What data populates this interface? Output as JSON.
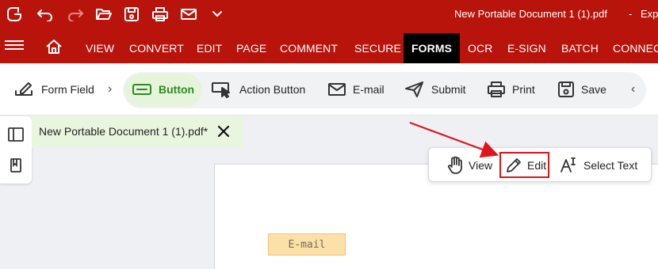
{
  "titlebar": {
    "doc_title": "New Portable Document 1 (1).pdf",
    "separator": "-",
    "app_title": "Exp"
  },
  "menubar": {
    "items": [
      "VIEW",
      "CONVERT",
      "EDIT",
      "PAGE",
      "COMMENT",
      "SECURE",
      "FORMS",
      "OCR",
      "E-SIGN",
      "BATCH",
      "CONNEC"
    ],
    "active": "FORMS"
  },
  "toolbar": {
    "form_field": "Form Field",
    "button": "Button",
    "action_button": "Action Button",
    "email": "E-mail",
    "submit": "Submit",
    "print": "Print",
    "save": "Save"
  },
  "doctab": {
    "label": "New Portable Document 1 (1).pdf*"
  },
  "page": {
    "email_field_label": "E-mail"
  },
  "mode_popup": {
    "view": "View",
    "edit": "Edit",
    "select_text": "Select Text",
    "selected": "Edit"
  },
  "colors": {
    "brand_red": "#b8140c",
    "active_green": "#2e8b1e",
    "highlight_red": "#e0141e"
  }
}
